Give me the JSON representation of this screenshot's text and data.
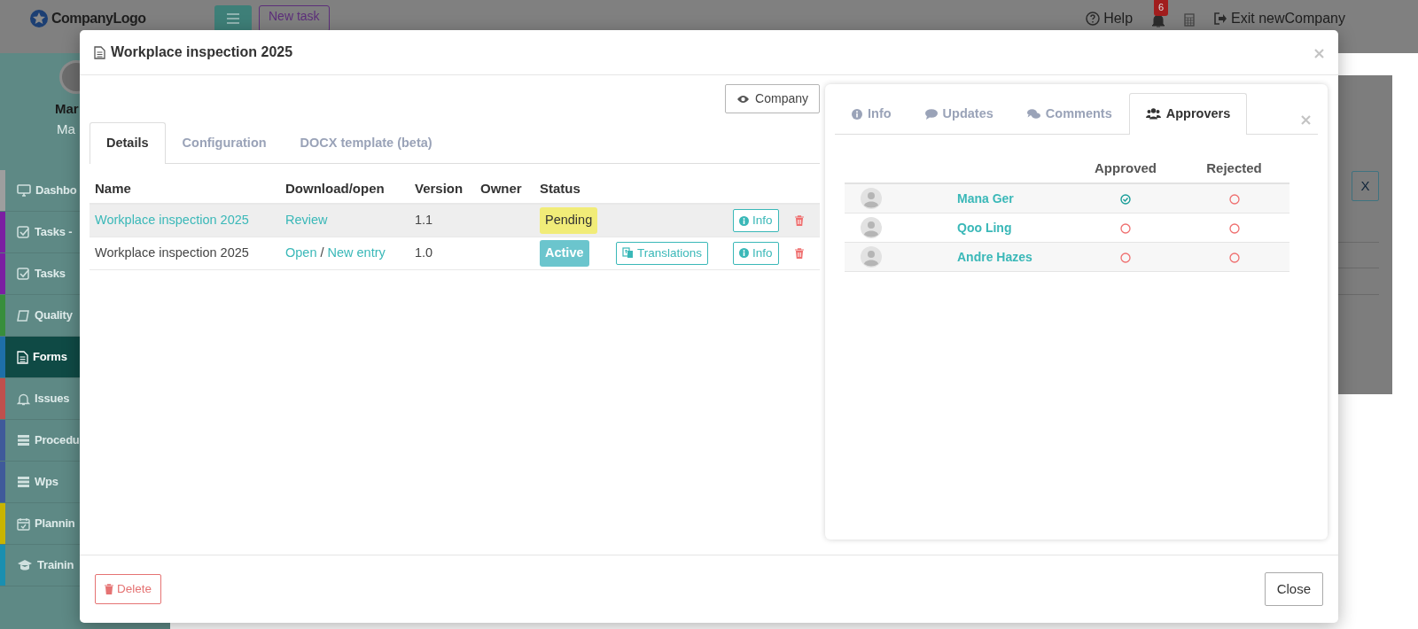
{
  "background": {
    "logo": "CompanyLogo",
    "new_task": "New task",
    "help": "Help",
    "notification_count": "6",
    "exit": "Exit newCompany",
    "user_name": "Mar",
    "user_role": "Ma",
    "panel_button": "X",
    "sidebar_items": [
      {
        "label": "Dashbo",
        "color": "#9e9e9e",
        "selected": false
      },
      {
        "label": "Tasks -",
        "color": "#7b1fa2",
        "selected": false
      },
      {
        "label": "Tasks",
        "color": "#7b1fa2",
        "selected": false
      },
      {
        "label": "Quality",
        "color": "#388e3c",
        "selected": false
      },
      {
        "label": "Forms",
        "color": "#1e6fa8",
        "selected": true
      },
      {
        "label": "Issues",
        "color": "#c0504d",
        "selected": false
      },
      {
        "label": "Procedu",
        "color": "#3f5a9a",
        "selected": false
      },
      {
        "label": "Wps",
        "color": "#3f5a9a",
        "selected": false
      },
      {
        "label": "Plannin",
        "color": "#c9b400",
        "selected": false
      },
      {
        "label": "Trainin",
        "color": "#1a8fb0",
        "selected": false
      }
    ]
  },
  "modal": {
    "title": "Workplace inspection 2025",
    "company_button": "Company",
    "tabs": [
      {
        "label": "Details",
        "selected": true
      },
      {
        "label": "Configuration",
        "selected": false
      },
      {
        "label": "DOCX template (beta)",
        "selected": false
      }
    ],
    "table": {
      "columns": [
        "Name",
        "Download/open",
        "Version",
        "Owner",
        "Status"
      ],
      "rows": [
        {
          "name": "Workplace inspection 2025",
          "name_is_link": true,
          "highlighted": true,
          "download": [
            {
              "kind": "link",
              "text": "Review"
            }
          ],
          "version": "1.1",
          "status": {
            "text": "Pending",
            "kind": "pending"
          },
          "info": "Info"
        },
        {
          "name": "Workplace inspection 2025",
          "name_is_link": false,
          "highlighted": false,
          "download": [
            {
              "kind": "link",
              "text": "Open"
            },
            {
              "kind": "text",
              "text": "/"
            },
            {
              "kind": "link",
              "text": "New entry"
            }
          ],
          "version": "1.0",
          "status": {
            "text": "Active",
            "kind": "active"
          },
          "translations": "Translations",
          "info": "Info"
        }
      ]
    },
    "side_panel": {
      "tabs": [
        {
          "label": "Info",
          "selected": false
        },
        {
          "label": "Updates",
          "selected": false
        },
        {
          "label": "Comments",
          "selected": false
        },
        {
          "label": "Approvers",
          "selected": true
        }
      ],
      "columns": [
        "Approved",
        "Rejected"
      ],
      "approvers": [
        {
          "name": "Mana Ger",
          "approved": true,
          "rejected": false
        },
        {
          "name": "Qoo Ling",
          "approved": false,
          "rejected": false
        },
        {
          "name": "Andre Hazes",
          "approved": false,
          "rejected": false
        }
      ]
    },
    "footer": {
      "delete": "Delete",
      "close": "Close"
    }
  }
}
